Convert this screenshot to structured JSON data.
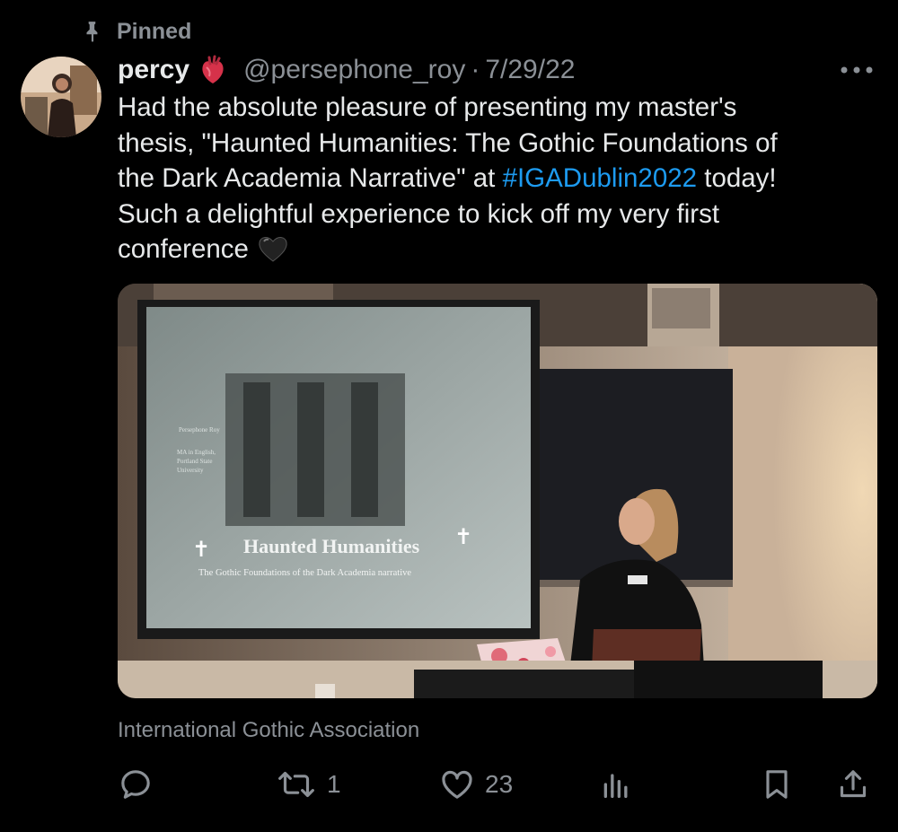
{
  "pinned": {
    "label": "Pinned",
    "icon": "pin-icon"
  },
  "author": {
    "display_name": "percy",
    "emoji": "anatomical-heart-icon",
    "handle": "@persephone_roy",
    "separator": "·",
    "date": "7/29/22"
  },
  "tweet": {
    "lines": [
      "Had the absolute pleasure of presenting my master's",
      "thesis, \"Haunted Humanities: The Gothic Foundations of",
      "the Dark Academia Narrative\" at ",
      "Such a delightful experience to kick off my very first",
      "conference"
    ],
    "hashtag": "#IGADublin2022",
    "after_hashtag": " today!",
    "trailing_emoji": "black-heart-icon"
  },
  "media": {
    "slide": {
      "author": "Persephone Roy",
      "credentials": [
        "MA in English,",
        "Portland State",
        "University"
      ],
      "title": "Haunted Humanities",
      "subtitle": "The Gothic Foundations of the Dark Academia narrative"
    }
  },
  "location": "International Gothic Association",
  "actions": {
    "reply": {
      "icon": "reply-icon",
      "count": ""
    },
    "retweet": {
      "icon": "retweet-icon",
      "count": "1"
    },
    "like": {
      "icon": "heart-icon",
      "count": "23"
    },
    "views": {
      "icon": "analytics-icon",
      "count": ""
    },
    "bookmark": {
      "icon": "bookmark-icon"
    },
    "share": {
      "icon": "share-icon"
    }
  },
  "colors": {
    "background": "#000000",
    "text": "#e7e9ea",
    "muted": "#8b9096",
    "link": "#1d9bf0"
  }
}
